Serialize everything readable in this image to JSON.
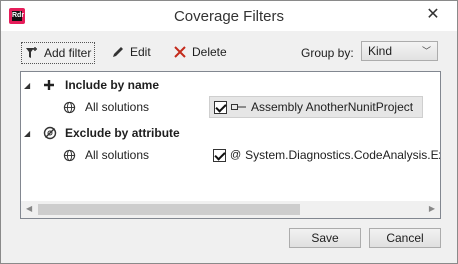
{
  "window": {
    "title": "Coverage Filters",
    "app_icon": "Rdr"
  },
  "toolbar": {
    "add_label": "Add filter",
    "edit_label": "Edit",
    "delete_label": "Delete",
    "group_by_label": "Group by:",
    "group_by_value": "Kind"
  },
  "groups": [
    {
      "label": "Include by name",
      "icon": "plus-icon",
      "solution": "All solutions",
      "rule": "Assembly AnotherNunitProject",
      "rule_icon": "assembly-icon",
      "checked": true,
      "selected": true
    },
    {
      "label": "Exclude by attribute",
      "icon": "exclude-attribute-icon",
      "solution": "All solutions",
      "rule": "System.Diagnostics.CodeAnalysis.Ex",
      "rule_icon": "attribute-icon",
      "checked": true,
      "selected": false
    }
  ],
  "buttons": {
    "save": "Save",
    "cancel": "Cancel"
  },
  "colors": {
    "app_icon": "#e61d5a",
    "delete_icon": "#c42b1c"
  }
}
